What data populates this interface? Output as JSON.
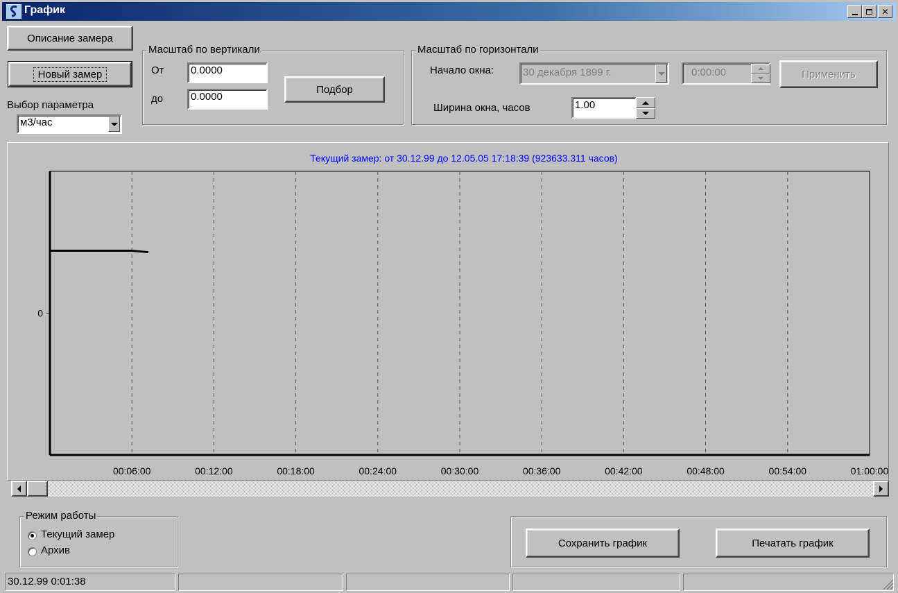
{
  "window": {
    "title": "График"
  },
  "toolbar": {
    "measurement_description": "Описание замера",
    "new_measurement": "Новый замер",
    "parameter_label": "Выбор параметра",
    "parameter_value": "м3/час"
  },
  "vertical_scale": {
    "title": "Масштаб по вертикали",
    "from_label": "От",
    "from_value": "0.0000",
    "to_label": "до",
    "to_value": "0.0000",
    "fit_button": "Подбор"
  },
  "horizontal_scale": {
    "title": "Масштаб по горизонтали",
    "window_start_label": "Начало окна:",
    "window_start_date": "30 декабря 1899 г.",
    "window_start_time": "0:00:00",
    "apply_button": "Применить",
    "width_label": "Ширина окна, часов",
    "width_value": "1.00"
  },
  "chart_data": {
    "type": "line",
    "title": "Текущий замер: от 30.12.99 до 12.05.05 17:18:39 (923633.311 часов)",
    "title_color": "#0000ff",
    "x_tick_labels": [
      "00:06:00",
      "00:12:00",
      "00:18:00",
      "00:24:00",
      "00:30:00",
      "00:36:00",
      "00:42:00",
      "00:48:00",
      "00:54:00",
      "01:00:00"
    ],
    "y_tick_labels": [
      "0"
    ],
    "xlim_minutes": [
      0,
      60
    ],
    "grid": "vertical dashed",
    "series": [
      {
        "x_minutes": [
          0,
          6,
          7.2
        ],
        "y_relative": [
          0.72,
          0.72,
          0.715
        ]
      }
    ]
  },
  "mode": {
    "title": "Режим работы",
    "options": [
      {
        "label": "Текущий замер",
        "checked": true
      },
      {
        "label": "Архив",
        "checked": false
      }
    ]
  },
  "actions": {
    "save_chart": "Сохранить график",
    "print_chart": "Печатать график"
  },
  "status_bar": {
    "cells": [
      "30.12.99 0:01:38",
      "",
      "",
      "",
      ""
    ]
  }
}
